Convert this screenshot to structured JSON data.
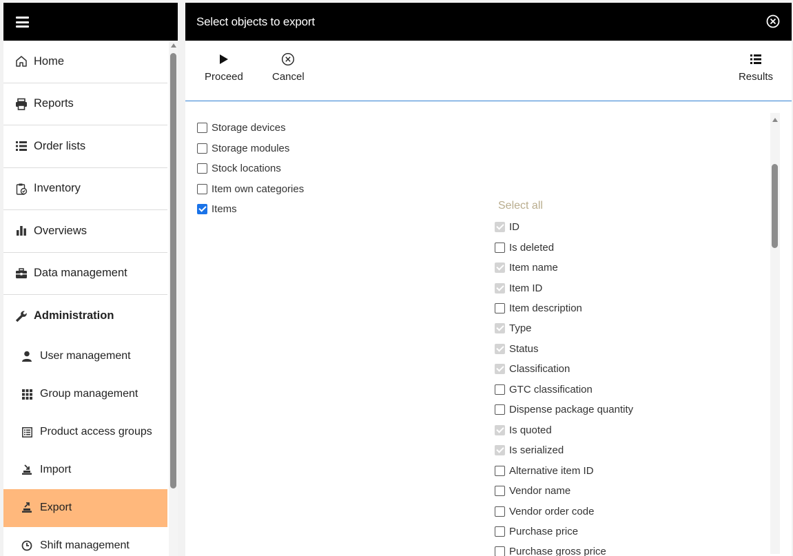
{
  "sidebar": {
    "menu_icon": "hamburger-icon",
    "items": [
      {
        "label": "Home",
        "icon": "home-icon"
      },
      {
        "label": "Reports",
        "icon": "printer-icon"
      },
      {
        "label": "Order lists",
        "icon": "list-icon"
      },
      {
        "label": "Inventory",
        "icon": "clipboard-check-icon"
      },
      {
        "label": "Overviews",
        "icon": "bar-chart-icon"
      },
      {
        "label": "Data management",
        "icon": "briefcase-icon"
      },
      {
        "label": "Administration",
        "icon": "wrench-icon"
      }
    ],
    "sub_items": [
      {
        "label": "User management",
        "icon": "user-icon"
      },
      {
        "label": "Group management",
        "icon": "grid-icon"
      },
      {
        "label": "Product access groups",
        "icon": "list-box-icon"
      },
      {
        "label": "Import",
        "icon": "import-icon"
      },
      {
        "label": "Export",
        "icon": "export-icon",
        "active": true
      },
      {
        "label": "Shift management",
        "icon": "clock-icon"
      }
    ]
  },
  "panel": {
    "title": "Select objects to export",
    "toolbar": {
      "proceed": "Proceed",
      "cancel": "Cancel",
      "results": "Results"
    }
  },
  "objects": [
    {
      "label": "Storage devices",
      "checked": false
    },
    {
      "label": "Storage modules",
      "checked": false
    },
    {
      "label": "Stock locations",
      "checked": false
    },
    {
      "label": "Item own categories",
      "checked": false
    },
    {
      "label": "Items",
      "checked": true
    }
  ],
  "fields": {
    "select_all": "Select all",
    "items": [
      {
        "label": "ID",
        "state": "disabled"
      },
      {
        "label": "Is deleted",
        "state": "unchecked"
      },
      {
        "label": "Item name",
        "state": "disabled"
      },
      {
        "label": "Item ID",
        "state": "disabled"
      },
      {
        "label": "Item description",
        "state": "unchecked"
      },
      {
        "label": "Type",
        "state": "disabled"
      },
      {
        "label": "Status",
        "state": "disabled"
      },
      {
        "label": "Classification",
        "state": "disabled"
      },
      {
        "label": "GTC classification",
        "state": "unchecked"
      },
      {
        "label": "Dispense package quantity",
        "state": "unchecked"
      },
      {
        "label": "Is quoted",
        "state": "disabled"
      },
      {
        "label": "Is serialized",
        "state": "disabled"
      },
      {
        "label": "Alternative item ID",
        "state": "unchecked"
      },
      {
        "label": "Vendor name",
        "state": "unchecked"
      },
      {
        "label": "Vendor order code",
        "state": "unchecked"
      },
      {
        "label": "Purchase price",
        "state": "unchecked"
      },
      {
        "label": "Purchase gross price",
        "state": "unchecked"
      }
    ]
  },
  "colors": {
    "header_bg": "#000000",
    "active_item_bg": "#ffb87c",
    "checkbox_checked": "#1a73e8",
    "select_all_text": "#b9ad8e",
    "toolbar_divider": "#2f7fd2"
  }
}
